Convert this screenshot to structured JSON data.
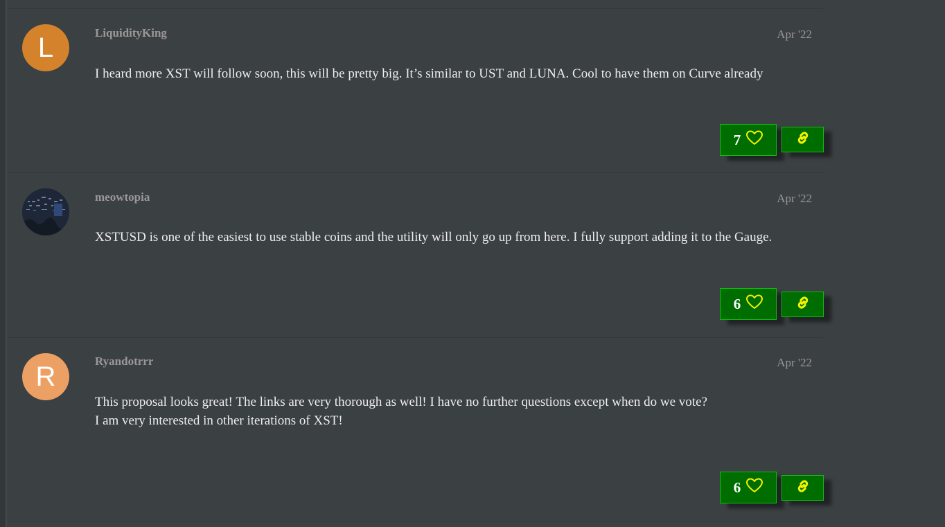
{
  "posts": [
    {
      "username": "LiquidityKing",
      "avatar_letter": "L",
      "avatar_color": "#d4822b",
      "date": "Apr '22",
      "body_lines": [
        "I heard more XST will follow soon, this will be pretty big. It’s similar to UST and LUNA. Cool to have them on Curve already"
      ],
      "likes": "7"
    },
    {
      "username": "meowtopia",
      "avatar_image": "dark-chart-image",
      "date": "Apr '22",
      "body_lines": [
        "XSTUSD is one of the easiest to use stable coins and the utility will only go up from here. I fully support adding it to the Gauge."
      ],
      "likes": "6"
    },
    {
      "username": "Ryandotrrr",
      "avatar_letter": "R",
      "avatar_color": "#eda064",
      "date": "Apr '22",
      "body_lines": [
        "This proposal looks great! The links are very thorough as well! I have no further questions except when do we vote?",
        "I am very interested in other iterations of XST!"
      ],
      "likes": "6"
    }
  ],
  "colors": {
    "background": "#3b4043",
    "button_bg": "#006d00",
    "button_border": "#0fbf0f",
    "icon_yellow": "#f3f300",
    "username": "#9a9896",
    "body_text": "#eeeeee"
  },
  "icons": {
    "like": "heart-icon",
    "share": "link-icon"
  }
}
